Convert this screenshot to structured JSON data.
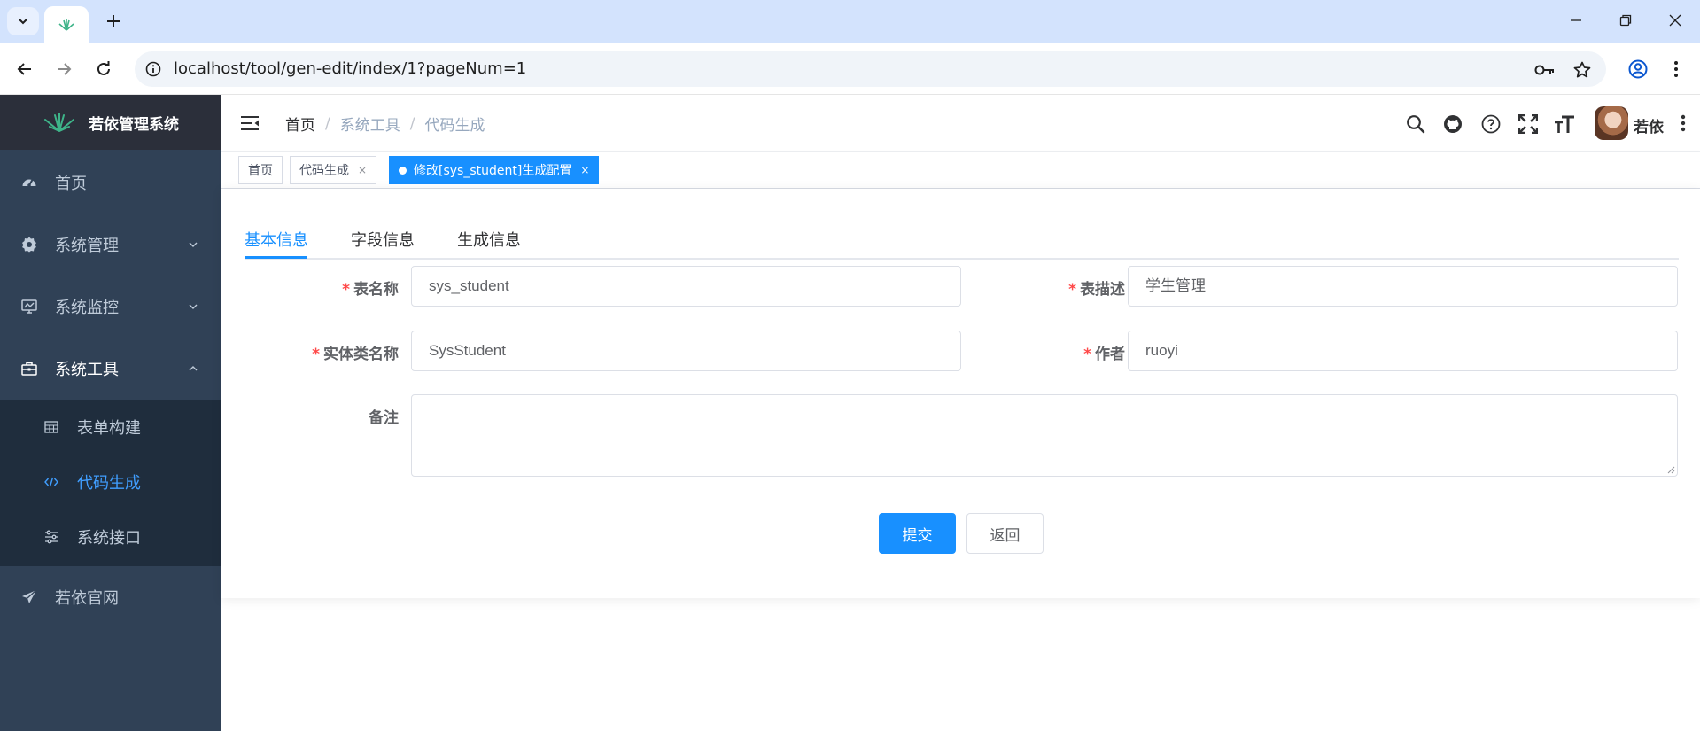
{
  "browser": {
    "url": "localhost/tool/gen-edit/index/1?pageNum=1"
  },
  "sidebar": {
    "logo_title": "若依管理系统",
    "items": [
      {
        "label": "首页",
        "icon": "dashboard-icon"
      },
      {
        "label": "系统管理",
        "icon": "gear-icon"
      },
      {
        "label": "系统监控",
        "icon": "monitor-icon"
      },
      {
        "label": "系统工具",
        "icon": "toolbox-icon"
      },
      {
        "label": "若依官网",
        "icon": "send-icon"
      }
    ],
    "sub_items": [
      {
        "label": "表单构建",
        "icon": "table-icon"
      },
      {
        "label": "代码生成",
        "icon": "code-icon"
      },
      {
        "label": "系统接口",
        "icon": "sliders-icon"
      }
    ]
  },
  "navbar": {
    "breadcrumb": [
      "首页",
      "系统工具",
      "代码生成"
    ],
    "separator": "/",
    "user_name": "若依"
  },
  "tagsview": {
    "tags": [
      {
        "label": "首页"
      },
      {
        "label": "代码生成",
        "close": "×"
      },
      {
        "label": "修改[sys_student]生成配置",
        "close": "×"
      }
    ]
  },
  "content": {
    "tabs": [
      "基本信息",
      "字段信息",
      "生成信息"
    ],
    "form": {
      "table_name_label": "表名称",
      "table_name_value": "sys_student",
      "table_desc_label": "表描述",
      "table_desc_value": "学生管理",
      "class_name_label": "实体类名称",
      "class_name_value": "SysStudent",
      "author_label": "作者",
      "author_value": "ruoyi",
      "remark_label": "备注",
      "required_mark": "*"
    },
    "buttons": {
      "submit": "提交",
      "back": "返回"
    }
  },
  "colors": {
    "primary": "#1890ff",
    "sidebar_bg": "#304156",
    "submenu_bg": "#1f2d3d",
    "required": "#ff4949"
  }
}
